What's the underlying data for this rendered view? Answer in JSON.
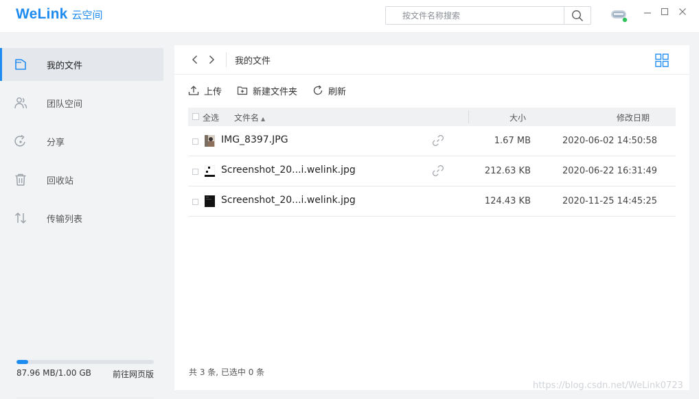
{
  "app": {
    "brand": "WeLink",
    "brand_sub": "云空间"
  },
  "search": {
    "placeholder": "按文件名称搜索"
  },
  "sidebar": {
    "items": [
      {
        "label": "我的文件",
        "icon": "folder-icon"
      },
      {
        "label": "团队空间",
        "icon": "team-icon"
      },
      {
        "label": "分享",
        "icon": "share-icon"
      },
      {
        "label": "回收站",
        "icon": "trash-icon"
      },
      {
        "label": "传输列表",
        "icon": "transfer-icon"
      }
    ],
    "storage": {
      "used_text": "87.96 MB/1.00 GB",
      "used_fraction": 0.086,
      "link": "前往网页版"
    }
  },
  "main": {
    "breadcrumb": "我的文件",
    "toolbar": {
      "upload": "上传",
      "new_folder": "新建文件夹",
      "refresh": "刷新"
    },
    "table": {
      "select_all": "全选",
      "col_name": "文件名",
      "sort_indicator": "▲",
      "col_size": "大小",
      "col_date": "修改日期",
      "rows": [
        {
          "name": "IMG_8397.JPG",
          "size": "1.67 MB",
          "date": "2020-06-02 14:50:58",
          "shared": true
        },
        {
          "name": "Screenshot_20...i.welink.jpg",
          "size": "212.63 KB",
          "date": "2020-06-22 16:31:49",
          "shared": true
        },
        {
          "name": "Screenshot_20...i.welink.jpg",
          "size": "124.43 KB",
          "date": "2020-11-25 14:45:25",
          "shared": false
        }
      ]
    },
    "status": "共 3 条, 已选中 0 条"
  },
  "watermark": "https://blog.csdn.net/WeLink0723",
  "colors": {
    "accent": "#1e8bf0",
    "sidebar_bg": "#f2f3f5",
    "active_bg": "#e4e7ec"
  }
}
